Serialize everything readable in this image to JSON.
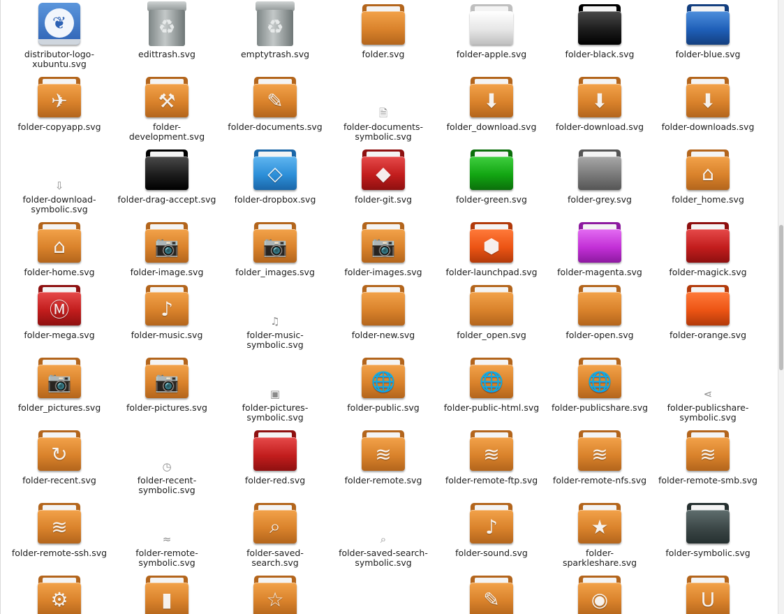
{
  "rows": [
    {
      "items": [
        {
          "label": "distributor-logo-xubuntu.svg",
          "kind": "logo",
          "icon": "xubuntu-logo-icon"
        },
        {
          "label": "edittrash.svg",
          "kind": "trash",
          "icon": "trash-icon"
        },
        {
          "label": "emptytrash.svg",
          "kind": "trash",
          "icon": "trash-icon"
        },
        {
          "label": "folder.svg",
          "kind": "folder",
          "color": "orange",
          "icon": "folder-icon"
        },
        {
          "label": "folder-apple.svg",
          "kind": "folder",
          "color": "silver",
          "emblem": "",
          "icon": "apple-folder-icon"
        },
        {
          "label": "folder-black.svg",
          "kind": "folder",
          "color": "black",
          "icon": "black-folder-icon"
        },
        {
          "label": "folder-blue.svg",
          "kind": "folder",
          "color": "blue",
          "icon": "blue-folder-icon"
        }
      ]
    },
    {
      "items": [
        {
          "label": "folder-copyapp.svg",
          "kind": "folder",
          "color": "orange",
          "emblem": "✈",
          "icon": "copyapp-folder-icon"
        },
        {
          "label": "folder-development.svg",
          "kind": "folder",
          "color": "orange",
          "emblem": "⚒",
          "icon": "development-folder-icon"
        },
        {
          "label": "folder-documents.svg",
          "kind": "folder",
          "color": "orange",
          "emblem": "✎",
          "icon": "documents-folder-icon"
        },
        {
          "label": "folder-documents-symbolic.svg",
          "kind": "symbolic",
          "glyph": "🗎",
          "icon": "documents-symbolic-icon"
        },
        {
          "label": "folder_download.svg",
          "kind": "folder",
          "color": "orange",
          "emblem": "⬇",
          "icon": "download-folder-icon"
        },
        {
          "label": "folder-download.svg",
          "kind": "folder",
          "color": "orange",
          "emblem": "⬇",
          "icon": "download-folder-icon"
        },
        {
          "label": "folder-downloads.svg",
          "kind": "folder",
          "color": "orange",
          "emblem": "⬇",
          "icon": "downloads-folder-icon"
        }
      ]
    },
    {
      "items": [
        {
          "label": "folder-download-symbolic.svg",
          "kind": "symbolic",
          "glyph": "⇩",
          "icon": "download-symbolic-icon"
        },
        {
          "label": "folder-drag-accept.svg",
          "kind": "folder",
          "color": "black",
          "icon": "drag-accept-folder-icon"
        },
        {
          "label": "folder-dropbox.svg",
          "kind": "folder",
          "color": "skyblue",
          "emblem": "◇",
          "icon": "dropbox-folder-icon"
        },
        {
          "label": "folder-git.svg",
          "kind": "folder",
          "color": "red",
          "emblem": "◆",
          "icon": "git-folder-icon"
        },
        {
          "label": "folder-green.svg",
          "kind": "folder",
          "color": "green",
          "icon": "green-folder-icon"
        },
        {
          "label": "folder-grey.svg",
          "kind": "folder",
          "color": "grey",
          "icon": "grey-folder-icon"
        },
        {
          "label": "folder_home.svg",
          "kind": "folder",
          "color": "orange",
          "emblem": "⌂",
          "icon": "home-folder-icon"
        }
      ]
    },
    {
      "items": [
        {
          "label": "folder-home.svg",
          "kind": "folder",
          "color": "orange",
          "emblem": "⌂",
          "icon": "home-folder-icon"
        },
        {
          "label": "folder-image.svg",
          "kind": "folder",
          "color": "orange",
          "emblem": "📷",
          "icon": "camera-folder-icon"
        },
        {
          "label": "folder_images.svg",
          "kind": "folder",
          "color": "orange",
          "emblem": "📷",
          "icon": "camera-folder-icon"
        },
        {
          "label": "folder-images.svg",
          "kind": "folder",
          "color": "orange",
          "emblem": "📷",
          "icon": "camera-folder-icon"
        },
        {
          "label": "folder-launchpad.svg",
          "kind": "folder",
          "color": "orangered",
          "emblem": "⬢",
          "icon": "launchpad-folder-icon"
        },
        {
          "label": "folder-magenta.svg",
          "kind": "folder",
          "color": "magenta",
          "icon": "magenta-folder-icon"
        },
        {
          "label": "folder-magick.svg",
          "kind": "folder",
          "color": "red",
          "icon": "magick-folder-icon"
        }
      ]
    },
    {
      "items": [
        {
          "label": "folder-mega.svg",
          "kind": "folder",
          "color": "red",
          "emblem": "Ⓜ",
          "icon": "mega-folder-icon"
        },
        {
          "label": "folder-music.svg",
          "kind": "folder",
          "color": "orange",
          "emblem": "♪",
          "icon": "music-folder-icon"
        },
        {
          "label": "folder-music-symbolic.svg",
          "kind": "symbolic",
          "glyph": "♫",
          "icon": "music-symbolic-icon"
        },
        {
          "label": "folder-new.svg",
          "kind": "folder",
          "color": "orange",
          "icon": "new-folder-icon"
        },
        {
          "label": "folder_open.svg",
          "kind": "folder",
          "color": "orange",
          "icon": "open-folder-icon"
        },
        {
          "label": "folder-open.svg",
          "kind": "folder",
          "color": "orange",
          "icon": "open-folder-icon"
        },
        {
          "label": "folder-orange.svg",
          "kind": "folder",
          "color": "orangered",
          "icon": "orange-folder-icon"
        }
      ]
    },
    {
      "items": [
        {
          "label": "folder_pictures.svg",
          "kind": "folder",
          "color": "orange",
          "emblem": "📷",
          "icon": "pictures-folder-icon"
        },
        {
          "label": "folder-pictures.svg",
          "kind": "folder",
          "color": "orange",
          "emblem": "📷",
          "icon": "pictures-folder-icon"
        },
        {
          "label": "folder-pictures-symbolic.svg",
          "kind": "symbolic",
          "glyph": "▣",
          "icon": "pictures-symbolic-icon"
        },
        {
          "label": "folder-public.svg",
          "kind": "folder",
          "color": "orange",
          "emblem": "🌐",
          "icon": "globe-folder-icon"
        },
        {
          "label": "folder-public-html.svg",
          "kind": "folder",
          "color": "orange",
          "emblem": "🌐",
          "icon": "globe-folder-icon"
        },
        {
          "label": "folder-publicshare.svg",
          "kind": "folder",
          "color": "orange",
          "emblem": "🌐",
          "icon": "globe-folder-icon"
        },
        {
          "label": "folder-publicshare-symbolic.svg",
          "kind": "symbolic",
          "glyph": "⋖",
          "icon": "share-symbolic-icon"
        }
      ]
    },
    {
      "items": [
        {
          "label": "folder-recent.svg",
          "kind": "folder",
          "color": "orange",
          "emblem": "↻",
          "icon": "recent-folder-icon"
        },
        {
          "label": "folder-recent-symbolic.svg",
          "kind": "symbolic",
          "glyph": "◷",
          "icon": "recent-symbolic-icon"
        },
        {
          "label": "folder-red.svg",
          "kind": "folder",
          "color": "red",
          "icon": "red-folder-icon"
        },
        {
          "label": "folder-remote.svg",
          "kind": "folder",
          "color": "orange",
          "emblem": "≋",
          "icon": "wifi-folder-icon"
        },
        {
          "label": "folder-remote-ftp.svg",
          "kind": "folder",
          "color": "orange",
          "emblem": "≋",
          "icon": "wifi-folder-icon"
        },
        {
          "label": "folder-remote-nfs.svg",
          "kind": "folder",
          "color": "orange",
          "emblem": "≋",
          "icon": "wifi-folder-icon"
        },
        {
          "label": "folder-remote-smb.svg",
          "kind": "folder",
          "color": "orange",
          "emblem": "≋",
          "icon": "wifi-folder-icon"
        }
      ]
    },
    {
      "items": [
        {
          "label": "folder-remote-ssh.svg",
          "kind": "folder",
          "color": "orange",
          "emblem": "≋",
          "icon": "wifi-folder-icon"
        },
        {
          "label": "folder-remote-symbolic.svg",
          "kind": "symbolic",
          "glyph": "≈",
          "icon": "remote-symbolic-icon"
        },
        {
          "label": "folder-saved-search.svg",
          "kind": "folder",
          "color": "orange",
          "emblem": "⌕",
          "icon": "search-folder-icon"
        },
        {
          "label": "folder-saved-search-symbolic.svg",
          "kind": "symbolic",
          "glyph": "⌕",
          "icon": "search-symbolic-icon"
        },
        {
          "label": "folder-sound.svg",
          "kind": "folder",
          "color": "orange",
          "emblem": "♪",
          "icon": "sound-folder-icon"
        },
        {
          "label": "folder-sparkleshare.svg",
          "kind": "folder",
          "color": "orange",
          "emblem": "★",
          "icon": "sparkleshare-folder-icon"
        },
        {
          "label": "folder-symbolic.svg",
          "kind": "folder",
          "color": "slate",
          "icon": "slate-folder-icon"
        }
      ]
    },
    {
      "items": [
        {
          "label": "",
          "kind": "folder",
          "color": "orange",
          "emblem": "⚙",
          "icon": "gear-folder-icon"
        },
        {
          "label": "",
          "kind": "folder",
          "color": "orange",
          "emblem": "▮",
          "icon": "zip-folder-icon"
        },
        {
          "label": "",
          "kind": "folder",
          "color": "orange",
          "emblem": "☆",
          "icon": "template-folder-icon"
        },
        {
          "label": "",
          "kind": "symbolic",
          "glyph": "",
          "icon": "symbolic-icon"
        },
        {
          "label": "",
          "kind": "folder",
          "color": "orange",
          "emblem": "✎",
          "icon": "text-folder-icon"
        },
        {
          "label": "",
          "kind": "folder",
          "color": "orange",
          "emblem": "◉",
          "icon": "ubuntu-folder-icon"
        },
        {
          "label": "",
          "kind": "folder",
          "color": "orange",
          "emblem": "U",
          "icon": "ubuntuone-folder-icon"
        }
      ]
    }
  ],
  "palette": {
    "orange": [
      "#f2a24a",
      "#d9822b",
      "#b3651c"
    ],
    "silver": [
      "#ffffff",
      "#e6e6e6",
      "#bfbfbf"
    ],
    "black": [
      "#4a4a4a",
      "#1c1c1c",
      "#000000"
    ],
    "blue": [
      "#4e8fdc",
      "#1f5fb8",
      "#133f7f"
    ],
    "skyblue": [
      "#5fb5f0",
      "#2d8fd8",
      "#1a66a8"
    ],
    "red": [
      "#e64a4a",
      "#c21d1d",
      "#8e1010"
    ],
    "green": [
      "#3fcf3f",
      "#12a512",
      "#0b6f0b"
    ],
    "grey": [
      "#a8a8a8",
      "#7a7a7a",
      "#555555"
    ],
    "orangered": [
      "#ff7a3a",
      "#ec5414",
      "#b23a0a"
    ],
    "magenta": [
      "#e36cf2",
      "#c22fd6",
      "#8d1aa0"
    ],
    "slate": [
      "#5f6e6e",
      "#3c4747",
      "#253030"
    ]
  }
}
